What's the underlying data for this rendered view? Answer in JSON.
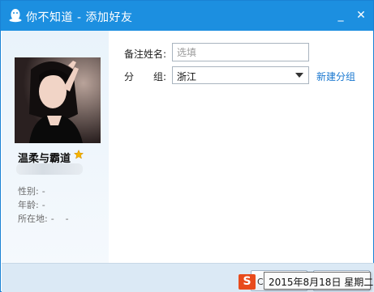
{
  "window": {
    "title": "你不知道 - 添加好友",
    "minimize_glyph": "_",
    "close_glyph": "✕",
    "accent_color": "#1c8fe0"
  },
  "profile": {
    "nickname": "温柔与霸道",
    "vip_icon": "star-icon",
    "gender_label": "性别:",
    "gender_value": "-",
    "age_label": "年龄:",
    "age_value": "-",
    "location_label": "所在地:",
    "location_value": "-    -"
  },
  "form": {
    "remark_label": "备注姓名:",
    "remark_placeholder": "选填",
    "remark_value": "",
    "group_label": "分　　组:",
    "group_value": "浙江",
    "new_group_link": "新建分组"
  },
  "taskbar": {
    "ime_logo": "S",
    "ime_letter": "C",
    "datetime_tooltip": "2015年8月18日 星期二"
  }
}
